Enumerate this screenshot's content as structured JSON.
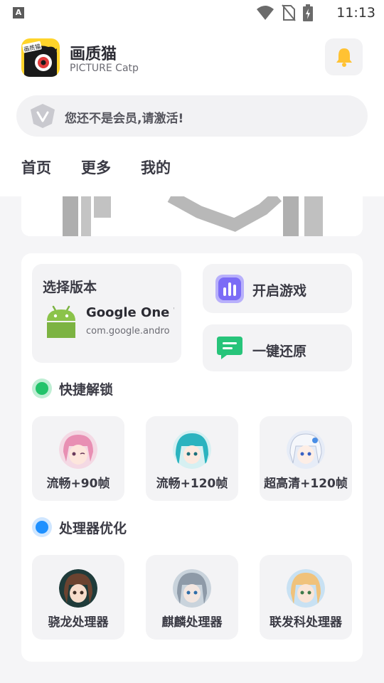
{
  "status_bar": {
    "time": "11:13",
    "left_icon": "A",
    "icons": [
      "wifi-icon",
      "no-sim-icon",
      "battery-charging-icon"
    ]
  },
  "header": {
    "app_name": "画质猫",
    "app_subtitle": "PICTURE Catp",
    "logo_text": "画质猫",
    "member_text": "您还不是会员,请激活!",
    "tabs": [
      {
        "label": "首页"
      },
      {
        "label": "更多"
      },
      {
        "label": "我的"
      }
    ]
  },
  "version": {
    "title": "选择版本",
    "package_name": "Google One Ti",
    "package_id": "com.google.andro"
  },
  "actions": {
    "start_game": "开启游戏",
    "restore": "一键还原"
  },
  "quick_unlock": {
    "title": "快捷解锁",
    "items": [
      {
        "label": "流畅+90帧"
      },
      {
        "label": "流畅+120帧"
      },
      {
        "label": "超高清+120帧"
      }
    ]
  },
  "processor": {
    "title": "处理器优化",
    "items": [
      {
        "label": "骁龙处理器"
      },
      {
        "label": "麒麟处理器"
      },
      {
        "label": "联发科处理器"
      }
    ]
  },
  "colors": {
    "accent_yellow": "#ffc233",
    "green_dot": "#22c36a",
    "blue_dot": "#1e90ff",
    "purple_icon": "#7b6cf6",
    "green_icon": "#27c47a"
  }
}
